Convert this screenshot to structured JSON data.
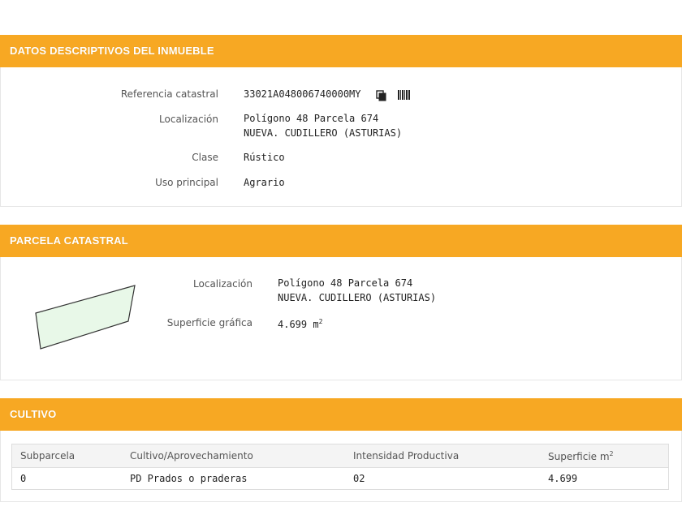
{
  "sections": {
    "descriptive": {
      "title": "DATOS DESCRIPTIVOS DEL INMUEBLE",
      "ref_label": "Referencia catastral",
      "ref_value": "33021A048006740000MY",
      "loc_label": "Localización",
      "loc_line1": "Polígono 48 Parcela 674",
      "loc_line2": "NUEVA. CUDILLERO (ASTURIAS)",
      "clase_label": "Clase",
      "clase_value": "Rústico",
      "uso_label": "Uso principal",
      "uso_value": "Agrario"
    },
    "parcel": {
      "title": "PARCELA CATASTRAL",
      "loc_label": "Localización",
      "loc_line1": "Polígono 48 Parcela 674",
      "loc_line2": "NUEVA. CUDILLERO (ASTURIAS)",
      "area_label": "Superficie gráfica",
      "area_value": "4.699 m",
      "area_unit_exp": "2"
    },
    "cultivo": {
      "title": "CULTIVO",
      "headers": [
        "Subparcela",
        "Cultivo/Aprovechamiento",
        "Intensidad Productiva",
        "Superficie m"
      ],
      "header_exp": "2",
      "rows": [
        [
          "0",
          "PD Prados o praderas",
          "02",
          "4.699"
        ]
      ]
    }
  },
  "icons": {
    "copy": "copy-icon",
    "barcode": "barcode-icon"
  },
  "colors": {
    "header_bg": "#f7a823",
    "parcel_fill": "#e8f8e8"
  }
}
